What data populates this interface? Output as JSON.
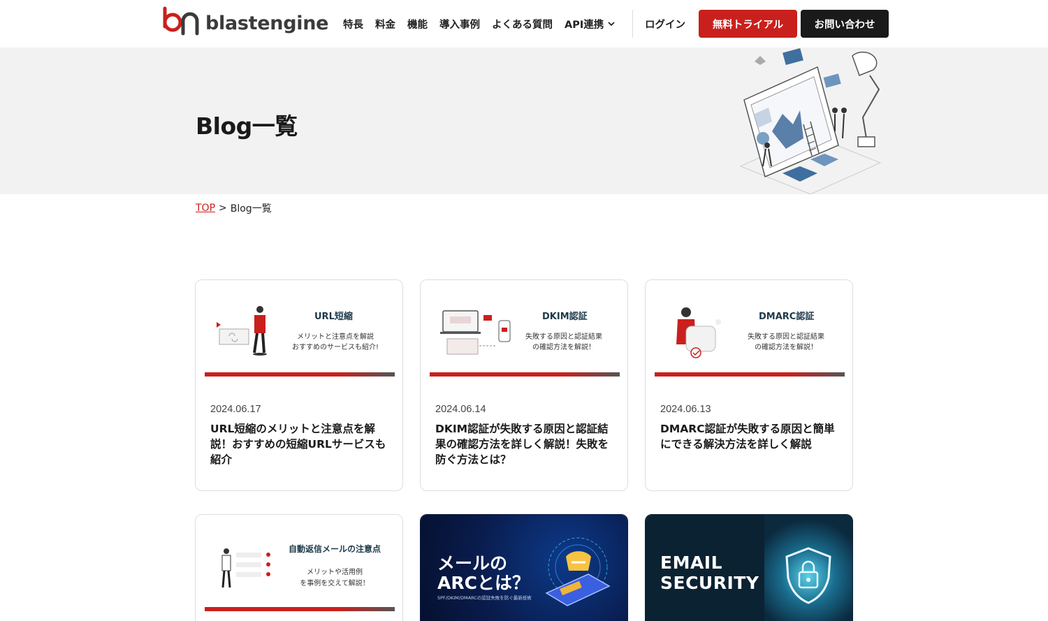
{
  "header": {
    "logo_text": "blastengine",
    "nav": [
      "特長",
      "料金",
      "機能",
      "導入事例",
      "よくある質問",
      "API連携"
    ],
    "login": "ログイン",
    "trial": "無料トライアル",
    "contact": "お問い合わせ"
  },
  "hero": {
    "title": "Blog一覧"
  },
  "breadcrumb": {
    "top": "TOP",
    "separator": ">",
    "current": "Blog一覧"
  },
  "posts": [
    {
      "thumb_title": "URL短縮",
      "thumb_sub1": "メリットと注意点を解説",
      "thumb_sub2": "おすすめのサービスも紹介!",
      "date": "2024.06.17",
      "title": "URL短縮のメリットと注意点を解説！おすすめの短縮URLサービスも紹介"
    },
    {
      "thumb_title": "DKIM認証",
      "thumb_sub1": "失敗する原因と認証結果",
      "thumb_sub2": "の確認方法を解説！",
      "date": "2024.06.14",
      "title": "DKIM認証が失敗する原因と認証結果の確認方法を詳しく解説！失敗を防ぐ方法とは？"
    },
    {
      "thumb_title": "DMARC認証",
      "thumb_sub1": "失敗する原因と認証結果",
      "thumb_sub2": "の確認方法を解説！",
      "date": "2024.06.13",
      "title": "DMARC認証が失敗する原因と簡単にできる解決方法を詳しく解説"
    },
    {
      "thumb_title": "自動返信メールの注意点",
      "thumb_sub1": "メリットや活用例",
      "thumb_sub2": "を事例を交えて解説！"
    },
    {
      "thumb_title1": "メールの",
      "thumb_title2": "ARCとは？",
      "thumb_sub": "SPF/DKIM/DMARCの認証失敗を防ぐ最新技術"
    },
    {
      "thumb_title1": "EMAIL",
      "thumb_title2": "SECURITY"
    }
  ],
  "colors": {
    "brand_red": "#c9201d",
    "dark": "#1a1a1a",
    "hero_bg": "#f2f2f2"
  }
}
